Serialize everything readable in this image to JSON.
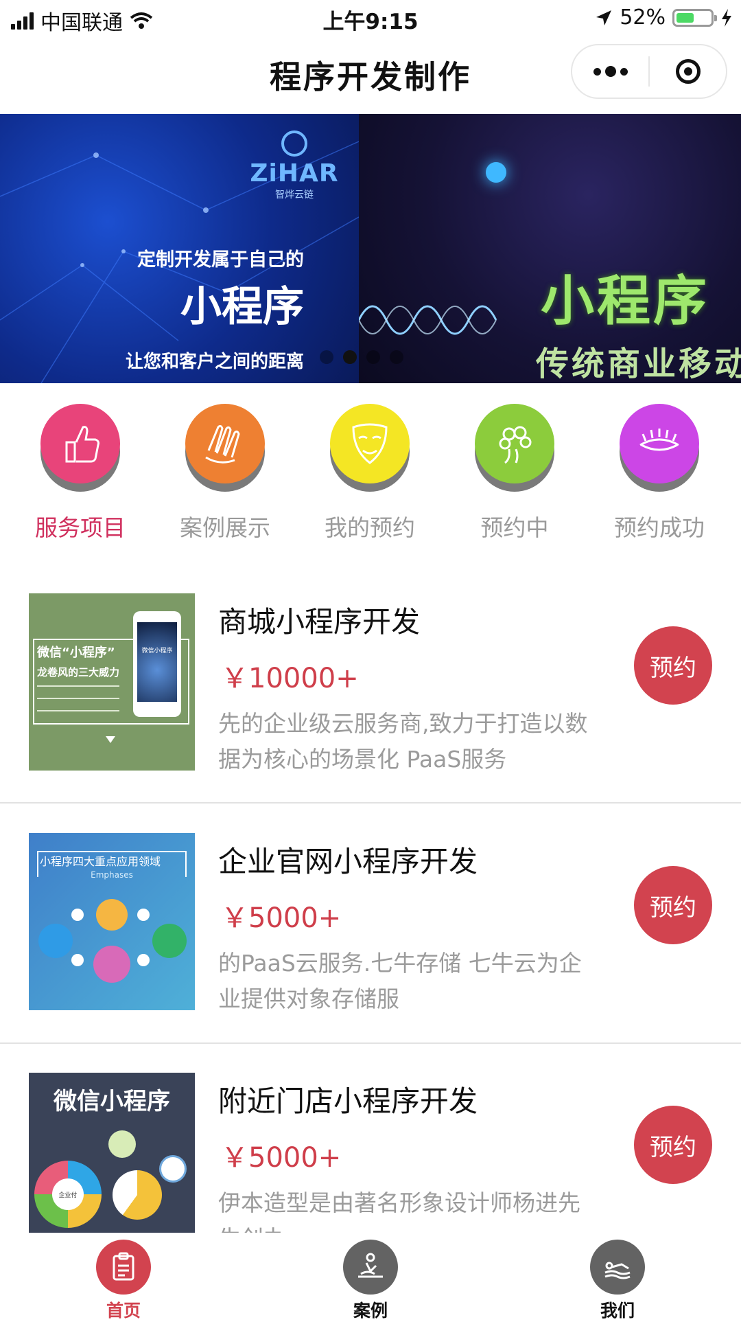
{
  "status_bar": {
    "carrier": "中国联通",
    "time": "上午9:15",
    "battery_text": "52%",
    "battery_level": 0.52,
    "battery_color": "#4cd964"
  },
  "nav": {
    "title": "程序开发制作"
  },
  "banner": {
    "slide_a": {
      "logo_text": "ZiHAR",
      "logo_sub": "智烨云链",
      "line1": "定制开发属于自己的",
      "headline": "小程序",
      "line3": "让您和客户之间的距离"
    },
    "slide_b": {
      "headline": "小程序",
      "subline": "传统商业移动"
    },
    "pager_count": 4,
    "pager_active": 1
  },
  "categories": [
    {
      "label": "服务项目",
      "icon": "thumbs-up-icon",
      "color": "#e8447a",
      "active": true
    },
    {
      "label": "案例展示",
      "icon": "nails-icon",
      "color": "#ee8032",
      "active": false
    },
    {
      "label": "我的预约",
      "icon": "mask-icon",
      "color": "#f4e624",
      "active": false
    },
    {
      "label": "预约中",
      "icon": "hair-icon",
      "color": "#8ccc3c",
      "active": false
    },
    {
      "label": "预约成功",
      "icon": "eyelash-icon",
      "color": "#cc46e6",
      "active": false
    }
  ],
  "items": [
    {
      "title": "商城小程序开发",
      "price": "￥10000+",
      "desc": "先的企业级云服务商,致力于打造以数据为核心的场景化 PaaS服务",
      "button": "预约",
      "thumb": {
        "heading": "微信“小程序”",
        "sub": "龙卷风的三大威力",
        "phone_label": "微信小程序"
      }
    },
    {
      "title": "企业官网小程序开发",
      "price": "￥5000+",
      "desc": "的PaaS云服务.七牛存储 七牛云为企业提供对象存储服",
      "button": "预约",
      "thumb": {
        "heading": "小程序四大重点应用领域",
        "sub": "Emphases"
      }
    },
    {
      "title": "附近门店小程序开发",
      "price": "￥5000+",
      "desc": "伊本造型是由著名形象设计师杨进先生创办",
      "button": "预约",
      "thumb": {
        "heading": "微信小程序",
        "center": "企业付"
      }
    }
  ],
  "tabbar": [
    {
      "label": "首页",
      "icon": "clipboard-icon",
      "active": true
    },
    {
      "label": "案例",
      "icon": "massage-icon",
      "active": false
    },
    {
      "label": "我们",
      "icon": "spa-icon",
      "active": false
    }
  ]
}
